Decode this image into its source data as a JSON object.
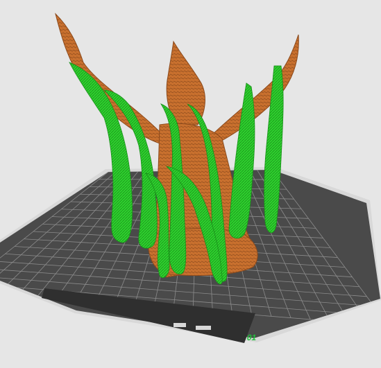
{
  "viewport": {
    "background": "#e6e6e6",
    "plate": {
      "label": "01",
      "label_color": "#1fbf3a",
      "surface_color": "#4a4a4a",
      "grid_color": "#8c8c8c",
      "frame_color": "#2f2f2f",
      "edge_color": "#d8d8d8"
    },
    "model": {
      "model_color": "#c8702e",
      "model_shadow": "#8c4a1c",
      "support_color": "#2ed12e",
      "support_shadow": "#1a8f1a"
    }
  }
}
